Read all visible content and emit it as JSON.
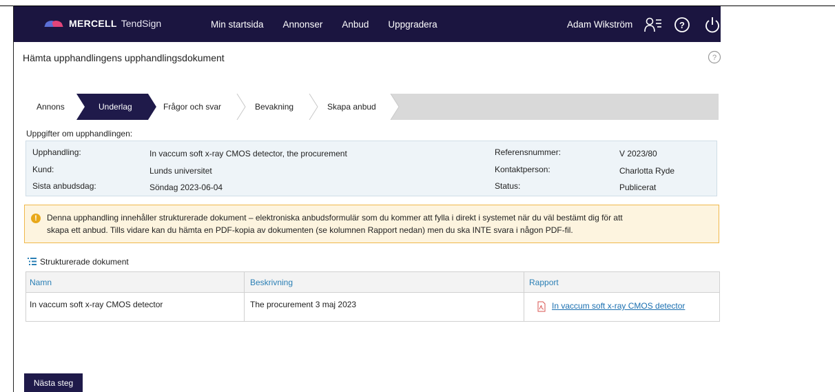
{
  "header": {
    "brand": "MERCELL",
    "product": "TendSign",
    "nav": [
      "Min startsida",
      "Annonser",
      "Anbud",
      "Uppgradera"
    ],
    "user_name": "Adam Wikström",
    "icons": {
      "user": "user-menu-icon",
      "help": "help-icon",
      "power": "power-icon"
    },
    "colors": {
      "bar": "#1b1540",
      "logo_pink": "#e2457a",
      "logo_blue": "#5b6fd6"
    }
  },
  "page": {
    "title": "Hämta upphandlingens upphandlingsdokument"
  },
  "steps": {
    "items": [
      "Annons",
      "Underlag",
      "Frågor och svar",
      "Bevakning",
      "Skapa anbud"
    ],
    "active": "Underlag"
  },
  "info": {
    "heading": "Uppgifter om upphandlingen:",
    "upphandling_label": "Upphandling:",
    "upphandling_value": "In vaccum soft x-ray CMOS detector, the procurement",
    "kund_label": "Kund:",
    "kund_value": "Lunds universitet",
    "sista_label": "Sista anbudsdag:",
    "sista_value": "Söndag 2023-06-04",
    "ref_label": "Referensnummer:",
    "ref_value": "V 2023/80",
    "kontakt_label": "Kontaktperson:",
    "kontakt_value": "Charlotta Ryde",
    "status_label": "Status:",
    "status_value": "Publicerat"
  },
  "notice": {
    "line1": "Denna upphandling innehåller strukturerade dokument – elektroniska anbudsformulär som du kommer att fylla i direkt i systemet när du väl bestämt dig för att",
    "line2": "skapa ett anbud. Tills vidare kan du hämta en PDF-kopia av dokumenten (se kolumnen Rapport nedan) men du ska INTE svara i någon PDF-fil."
  },
  "documents": {
    "title": "Strukturerade dokument",
    "columns": [
      "Namn",
      "Beskrivning",
      "Rapport"
    ],
    "rows": [
      {
        "name": "In vaccum soft x-ray CMOS detector",
        "description": "The procurement 3 maj 2023",
        "report": "In vaccum soft x-ray CMOS detector"
      }
    ]
  },
  "actions": {
    "next": "Nästa steg"
  }
}
